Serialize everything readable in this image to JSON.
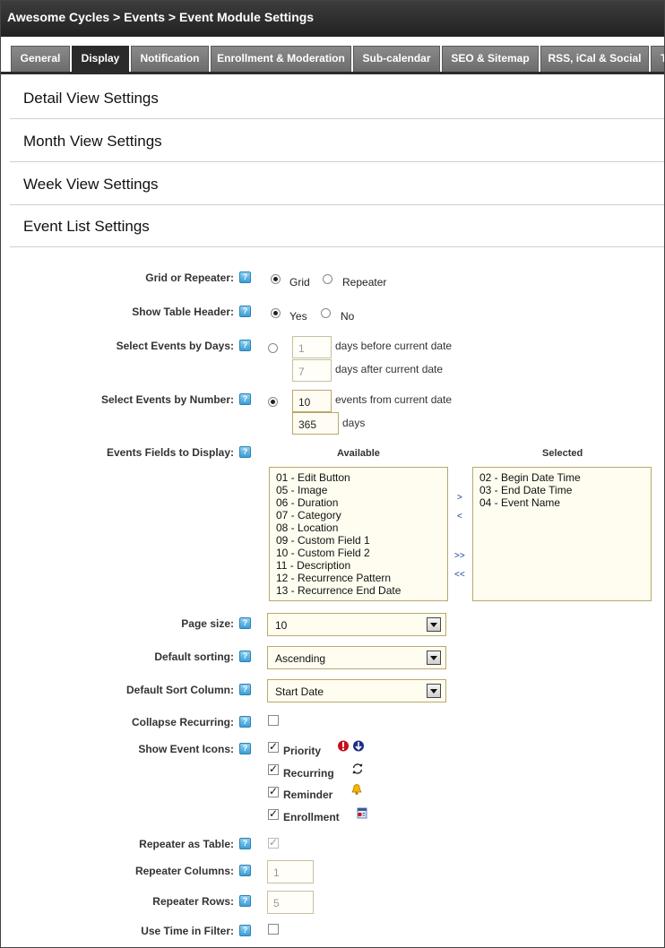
{
  "breadcrumb": "Awesome Cycles > Events > Event Module Settings",
  "tabs": [
    {
      "label": "General"
    },
    {
      "label": "Display"
    },
    {
      "label": "Notification"
    },
    {
      "label": "Enrollment & Moderation"
    },
    {
      "label": "Sub-calendar"
    },
    {
      "label": "SEO & Sitemap"
    },
    {
      "label": "RSS, iCal & Social"
    },
    {
      "label": "T"
    }
  ],
  "active_tab": "Display",
  "sections": {
    "detail": "Detail View Settings",
    "month": "Month View Settings",
    "week": "Week View Settings",
    "eventlist": "Event List Settings"
  },
  "help_glyph": "?",
  "fields": {
    "grid_or_repeater": {
      "label": "Grid or Repeater:",
      "opt1": "Grid",
      "opt2": "Repeater",
      "selected": "Grid"
    },
    "show_table_header": {
      "label": "Show Table Header:",
      "opt1": "Yes",
      "opt2": "No",
      "selected": "Yes"
    },
    "select_by_days": {
      "label": "Select Events by Days:",
      "before_value": "1",
      "before_text": "days before current date",
      "after_value": "7",
      "after_text": "days after current date"
    },
    "select_by_number": {
      "label": "Select Events by Number:",
      "number_value": "10",
      "number_text": "events from current date",
      "days_value": "365",
      "days_text": "days"
    },
    "fields_to_display": {
      "label": "Events Fields to Display:",
      "available_header": "Available",
      "selected_header": "Selected",
      "available": [
        "01 - Edit Button",
        "05 - Image",
        "06 - Duration",
        "07 - Category",
        "08 - Location",
        "09 - Custom Field 1",
        "10 - Custom Field 2",
        "11 - Description",
        "12 - Recurrence Pattern",
        "13 - Recurrence End Date"
      ],
      "selected": [
        "02 - Begin Date Time",
        "03 - End Date Time",
        "04 - Event Name"
      ],
      "move_right": ">",
      "move_left": "<",
      "move_all_right": ">>",
      "move_all_left": "<<"
    },
    "page_size": {
      "label": "Page size:",
      "value": "10"
    },
    "default_sorting": {
      "label": "Default sorting:",
      "value": "Ascending"
    },
    "default_sort_column": {
      "label": "Default Sort Column:",
      "value": "Start Date"
    },
    "collapse_recurring": {
      "label": "Collapse Recurring:",
      "checked": false
    },
    "show_event_icons": {
      "label": "Show Event Icons:",
      "items": [
        {
          "label": "Priority",
          "checked": true,
          "icon": "priority-icon"
        },
        {
          "label": "Recurring",
          "checked": true,
          "icon": "recurring-icon"
        },
        {
          "label": "Reminder",
          "checked": true,
          "icon": "bell-icon"
        },
        {
          "label": "Enrollment",
          "checked": true,
          "icon": "enrollment-icon"
        }
      ]
    },
    "repeater_as_table": {
      "label": "Repeater as Table:",
      "checked": true,
      "disabled": true
    },
    "repeater_columns": {
      "label": "Repeater Columns:",
      "value": "1"
    },
    "repeater_rows": {
      "label": "Repeater Rows:",
      "value": "5"
    },
    "use_time_in_filter": {
      "label": "Use Time in Filter:",
      "checked": false
    }
  },
  "colors": {
    "accent": "#2b2b2b",
    "tab": "#7a7a7a",
    "help": "#3a9fd8",
    "input_border": "#b9a96a"
  }
}
